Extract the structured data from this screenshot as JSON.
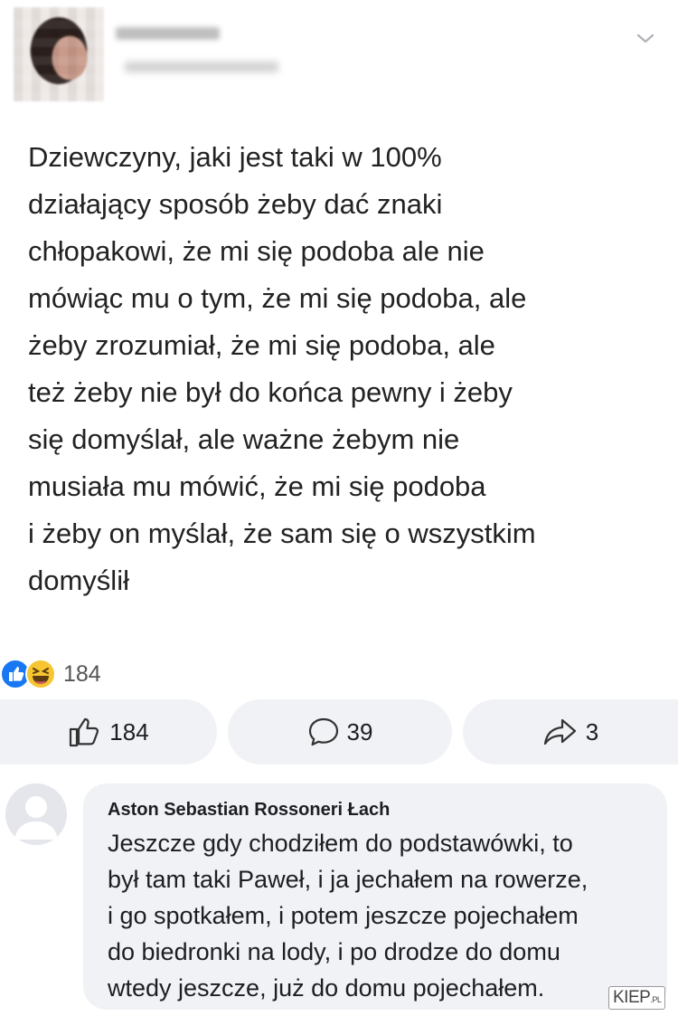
{
  "post": {
    "text": "Dziewczyny, jaki jest taki w 100%\ndziałający sposób żeby dać znaki\nchłopakowi, że mi się podoba ale nie\nmówiąc mu o tym, że mi się podoba, ale\nżeby zrozumiał, że mi się podoba, ale\nteż żeby nie był do końca pewny i żeby\nsię domyślał, ale ważne żebym nie\nmusiała mu mówić, że mi się podoba\ni żeby on myślał, że sam się o wszystkim\ndomyślił"
  },
  "reactions": {
    "count": "184",
    "icons": [
      "like-icon",
      "haha-icon"
    ]
  },
  "actions": {
    "like_count": "184",
    "comment_count": "39",
    "share_count": "3"
  },
  "comment": {
    "author": "Aston Sebastian Rossoneri Łach",
    "text": "Jeszcze gdy chodziłem do podstawówki, to\nbył tam taki Paweł, i ja jechałem na rowerze,\ni go spotkałem, i potem jeszcze pojechałem\ndo biedronki na lody, i po drodze do domu\nwtedy jeszcze, już do domu pojechałem."
  },
  "watermark": {
    "main": "KIEP",
    "suffix": ".PL"
  },
  "colors": {
    "like_blue": "#1877f2",
    "haha_yellow": "#f7c531",
    "button_bg": "#f0f2f5"
  }
}
